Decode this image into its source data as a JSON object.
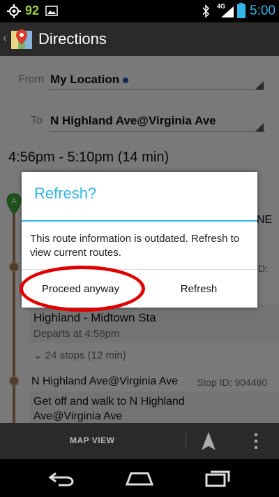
{
  "status_bar": {
    "battery_level": "92",
    "network": "4G",
    "time": "5:00"
  },
  "action_bar": {
    "title": "Directions"
  },
  "form": {
    "from_label": "From",
    "from_value": "My Location",
    "to_label": "To",
    "to_value": "N Highland Ave@Virginia Ave"
  },
  "trip": {
    "time_range": "4:56pm - 5:10pm (14 min)",
    "partial_ne": "NE",
    "partial_id": "D:",
    "station": "Highland - Midtown Sta",
    "departs": "Departs at 4:56pm",
    "stops": "24 stops (12 min)",
    "stop_name": "N Highland Ave@Virginia Ave",
    "stop_id": "Stop ID: 904480",
    "instruction_line1": "Get off and walk to N Highland",
    "instruction_line2": "Ave@Virginia Ave"
  },
  "dialog": {
    "title": "Refresh?",
    "message": "This route information is outdated. Refresh to view current routes.",
    "proceed_label": "Proceed anyway",
    "refresh_label": "Refresh"
  },
  "toolbar": {
    "map_view_label": "MAP VIEW"
  },
  "colors": {
    "accent": "#33b5e5",
    "route": "#a07a52",
    "annotation": "#e00000"
  },
  "icons": [
    "gps-icon",
    "image-icon",
    "bluetooth-icon",
    "signal-icon",
    "battery-icon",
    "maps-logo-icon",
    "navigation-arrow-icon",
    "overflow-menu-icon",
    "back-nav-icon",
    "home-nav-icon",
    "recent-apps-icon"
  ]
}
